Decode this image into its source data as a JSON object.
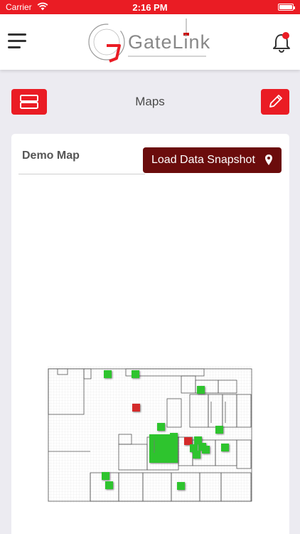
{
  "status_bar": {
    "carrier": "Carrier",
    "time": "2:16 PM"
  },
  "header": {
    "logo_text": "GateLink",
    "icons": {
      "menu": "hamburger-menu-icon",
      "notifications": "bell-icon"
    },
    "notification_dot_color": "#ea1c24"
  },
  "toolbar": {
    "title": "Maps",
    "icons": {
      "layers": "layers-icon",
      "edit": "pencil-icon"
    }
  },
  "map_card": {
    "map_name": "Demo Map",
    "load_button_label": "Load Data Snapshot",
    "load_button_icon": "map-pin-icon"
  },
  "colors": {
    "brand_red": "#ea1c24",
    "dark_red": "#6b0c0c",
    "marker_green": "#2ec42e",
    "marker_red": "#d42a2a"
  }
}
